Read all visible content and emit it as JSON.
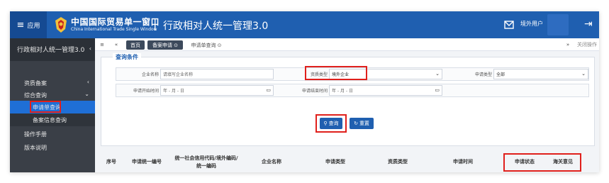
{
  "topbar": {
    "apps_label": "应用",
    "brand_cn": "中国国际贸易单一窗口",
    "brand_en": "China International Trade Single Window",
    "divider": "|",
    "system_title": "行政相对人统一管理3.0",
    "user_label": "境外用户",
    "icons": [
      "menu-icon",
      "emblem-logo",
      "mail-icon",
      "logout-icon"
    ]
  },
  "sidebar": {
    "header": "行政相对人统一管理3.0",
    "header_chevron": "‹",
    "items": [
      {
        "label": "资质备案",
        "arrow": "‹"
      },
      {
        "label": "综合查询",
        "arrow": "⌄"
      },
      {
        "label": "申请单查询"
      },
      {
        "label": "备案信息查询"
      },
      {
        "label": "操作手册"
      },
      {
        "label": "版本说明"
      }
    ]
  },
  "tabs": {
    "prev": "≡",
    "back": "«",
    "home": "首页",
    "active": "备案申请 ⊙",
    "current": "申请单查询 ⊙",
    "next": "»",
    "close_all": "关闭操作"
  },
  "query": {
    "title": "查询条件",
    "enterprise_label": "企业名称",
    "enterprise_placeholder": "请填写企业名称",
    "qualification_label": "资质类型",
    "qualification_value": "境外企业",
    "apply_type_label": "申请类型",
    "apply_type_value": "全部",
    "start_label": "申请开始时间",
    "start_placeholder": "年 - 月 - 日",
    "end_label": "申请结束时间",
    "end_placeholder": "年 - 月 - 日",
    "search_button": "查询",
    "reset_button": "重置"
  },
  "table": {
    "columns": [
      "序号",
      "申请统一编号",
      "统一社会信用代码/境外编码/统一编码",
      "企业名称",
      "申请类型",
      "资质类型",
      "申请时间",
      "申请状态",
      "海关意见"
    ]
  },
  "colors": {
    "topbar": "#1f5fb0",
    "sidebar": "#3a3f47",
    "active": "#1f6fd6",
    "highlight": "#e0201c"
  }
}
